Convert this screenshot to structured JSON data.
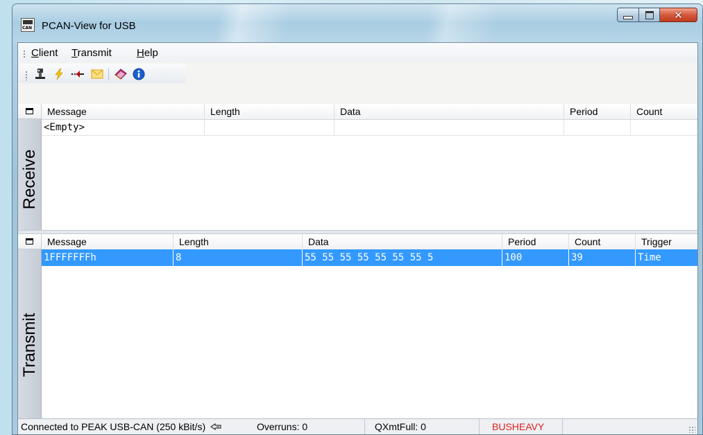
{
  "window": {
    "title": "PCAN-View for USB"
  },
  "menu": {
    "items": [
      {
        "prefix": "",
        "accel": "C",
        "rest": "lient"
      },
      {
        "prefix": "",
        "accel": "T",
        "rest": "ransmit"
      },
      {
        "prefix": "",
        "accel": "H",
        "rest": "elp"
      }
    ]
  },
  "toolbar": {
    "icons": [
      "connect-icon",
      "reset-icon",
      "new-message-icon",
      "edit-message-icon",
      "manual-icon",
      "info-icon"
    ]
  },
  "receive": {
    "pane_label": "Receive",
    "columns": [
      "Message",
      "Length",
      "Data",
      "Period",
      "Count"
    ],
    "rows": [
      {
        "message": "<Empty>",
        "length": "",
        "data": "",
        "period": "",
        "count": ""
      }
    ]
  },
  "transmit": {
    "pane_label": "Transmit",
    "columns": [
      "Message",
      "Length",
      "Data",
      "Period",
      "Count",
      "Trigger"
    ],
    "rows": [
      {
        "message": "1FFFFFFFh",
        "length": "8",
        "data": "55 55 55 55 55 55 55 5",
        "period": "100",
        "count": "39",
        "trigger": "Time",
        "selected": true
      }
    ]
  },
  "status": {
    "connection": "Connected to PEAK USB-CAN (250 kBit/s)",
    "overruns": "Overruns: 0",
    "qxmtfull": "QXmtFull: 0",
    "bus_state": "BUSHEAVY",
    "bus_state_color": "#e02020",
    "selection_color": "#3399ff"
  }
}
